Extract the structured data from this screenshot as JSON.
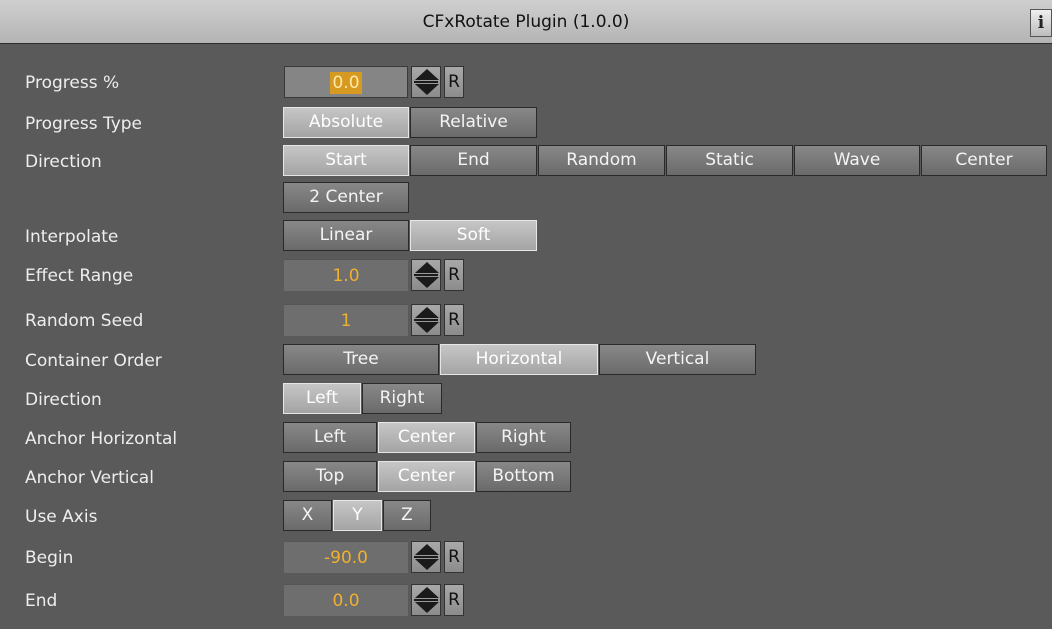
{
  "window": {
    "title": "CFxRotate Plugin (1.0.0)",
    "info_label": "i"
  },
  "rows": {
    "progress": {
      "label": "Progress %",
      "value": "0.0",
      "reset": "R"
    },
    "progress_type": {
      "label": "Progress Type",
      "options": [
        "Absolute",
        "Relative"
      ],
      "selected": "Absolute"
    },
    "direction": {
      "label": "Direction",
      "options": [
        "Start",
        "End",
        "Random",
        "Static",
        "Wave",
        "Center",
        "2 Center"
      ],
      "selected": "Start"
    },
    "interpolate": {
      "label": "Interpolate",
      "options": [
        "Linear",
        "Soft"
      ],
      "selected": "Soft"
    },
    "effect_range": {
      "label": "Effect Range",
      "value": "1.0",
      "reset": "R"
    },
    "random_seed": {
      "label": "Random Seed",
      "value": "1",
      "reset": "R"
    },
    "container_order": {
      "label": "Container Order",
      "options": [
        "Tree",
        "Horizontal",
        "Vertical"
      ],
      "selected": "Horizontal"
    },
    "direction2": {
      "label": "Direction",
      "options": [
        "Left",
        "Right"
      ],
      "selected": "Left"
    },
    "anchor_horizontal": {
      "label": "Anchor Horizontal",
      "options": [
        "Left",
        "Center",
        "Right"
      ],
      "selected": "Center"
    },
    "anchor_vertical": {
      "label": "Anchor Vertical",
      "options": [
        "Top",
        "Center",
        "Bottom"
      ],
      "selected": "Center"
    },
    "use_axis": {
      "label": "Use Axis",
      "options": [
        "X",
        "Y",
        "Z"
      ],
      "selected": "Y"
    },
    "begin": {
      "label": "Begin",
      "value": "-90.0",
      "reset": "R"
    },
    "end": {
      "label": "End",
      "value": "0.0",
      "reset": "R"
    }
  },
  "icons": {
    "spinner": "up-down-arrows-icon",
    "info": "info-icon"
  }
}
